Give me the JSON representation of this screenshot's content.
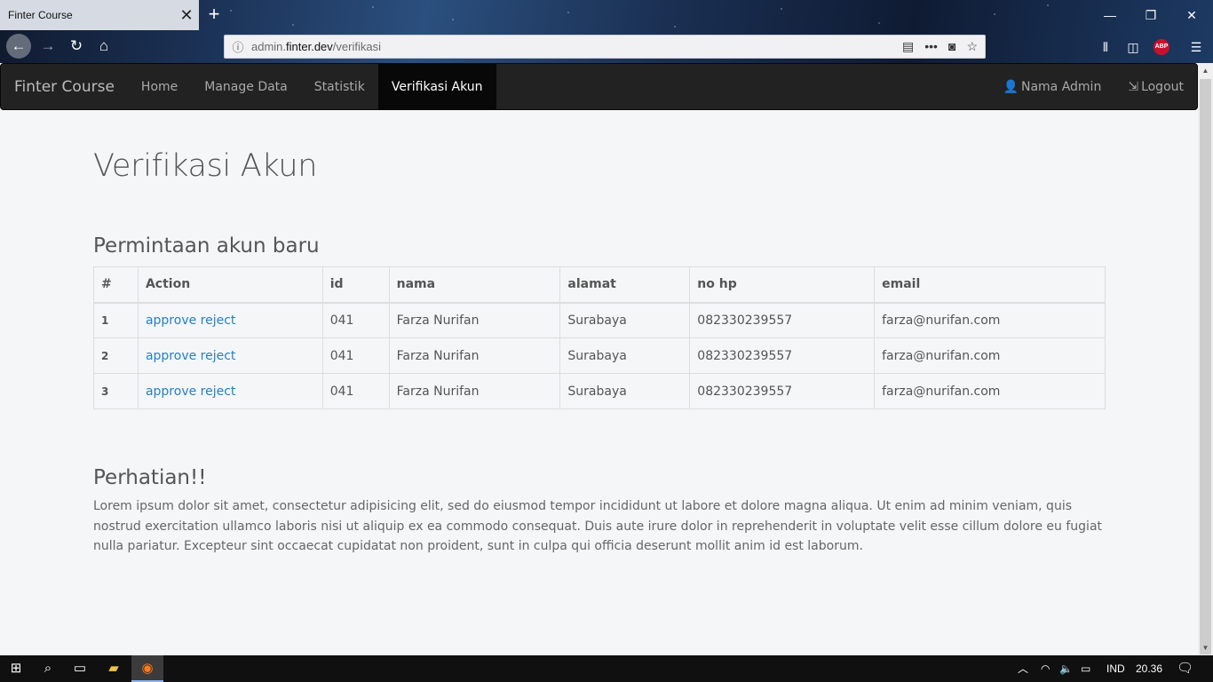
{
  "browser": {
    "tab_title": "Finter Course",
    "tab_close": "✕",
    "new_tab": "+",
    "url_prefix": "admin.",
    "url_host": "finter.dev",
    "url_path": "/verifikasi",
    "win_min": "—",
    "win_restore": "❐",
    "win_close": "✕"
  },
  "navbar": {
    "brand": "Finter Course",
    "links": [
      "Home",
      "Manage Data",
      "Statistik",
      "Verifikasi Akun"
    ],
    "user": "Nama Admin",
    "logout": "Logout"
  },
  "page": {
    "title": "Verifikasi Akun",
    "section_title": "Permintaan akun baru",
    "columns": [
      "#",
      "Action",
      "id",
      "nama",
      "alamat",
      "no hp",
      "email"
    ],
    "rows": [
      {
        "num": "1",
        "approve": "approve",
        "reject": "reject",
        "id": "041",
        "nama": "Farza Nurifan",
        "alamat": "Surabaya",
        "hp": "082330239557",
        "email": "farza@nurifan.com"
      },
      {
        "num": "2",
        "approve": "approve",
        "reject": "reject",
        "id": "041",
        "nama": "Farza Nurifan",
        "alamat": "Surabaya",
        "hp": "082330239557",
        "email": "farza@nurifan.com"
      },
      {
        "num": "3",
        "approve": "approve",
        "reject": "reject",
        "id": "041",
        "nama": "Farza Nurifan",
        "alamat": "Surabaya",
        "hp": "082330239557",
        "email": "farza@nurifan.com"
      }
    ],
    "warning_title": "Perhatian!!",
    "warning_text": "Lorem ipsum dolor sit amet, consectetur adipisicing elit, sed do eiusmod tempor incididunt ut labore et dolore magna aliqua. Ut enim ad minim veniam, quis nostrud exercitation ullamco laboris nisi ut aliquip ex ea commodo consequat. Duis aute irure dolor in reprehenderit in voluptate velit esse cillum dolore eu fugiat nulla pariatur. Excepteur sint occaecat cupidatat non proident, sunt in culpa qui officia deserunt mollit anim id est laborum."
  },
  "taskbar": {
    "lang": "IND",
    "time": "20.36"
  },
  "colors": {
    "link": "#2780c2",
    "navbar_bg": "#222222",
    "navbar_active": "#080808",
    "page_bg": "#f4f6f8"
  }
}
